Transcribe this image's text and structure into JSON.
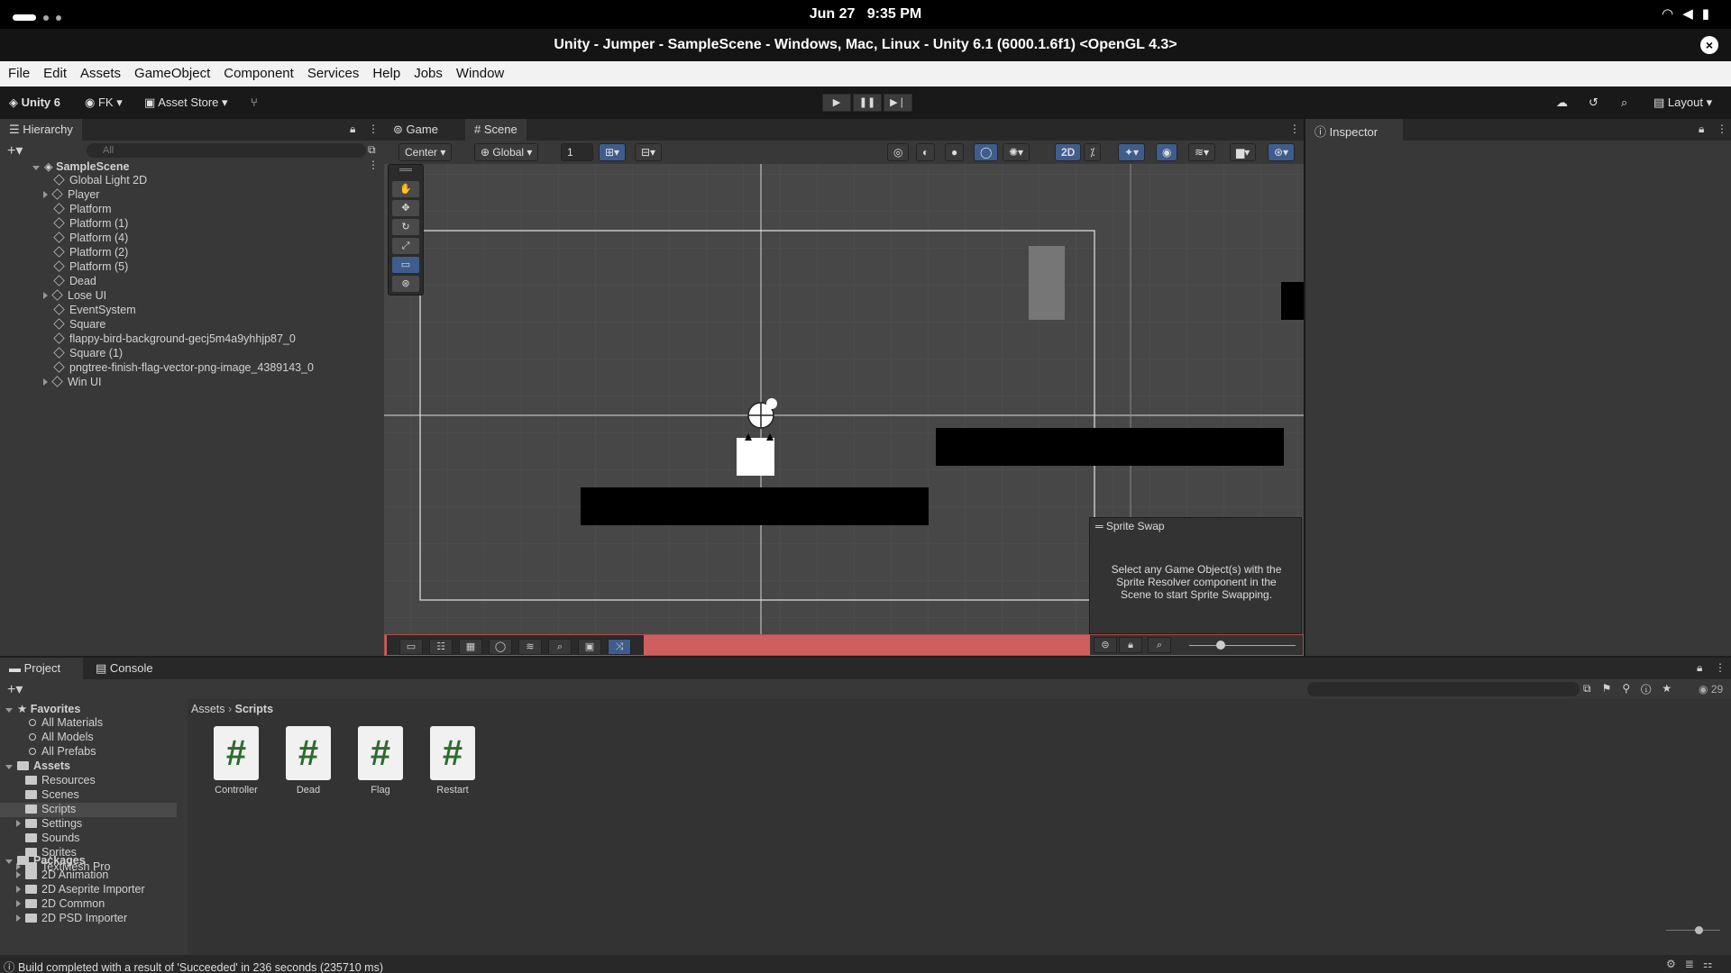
{
  "os": {
    "date": "Jun 27",
    "time": "9:35 PM"
  },
  "window": {
    "title": "Unity - Jumper - SampleScene - Windows, Mac, Linux - Unity 6.1 (6000.1.6f1) <OpenGL 4.3>"
  },
  "menu": [
    "File",
    "Edit",
    "Assets",
    "GameObject",
    "Component",
    "Services",
    "Help",
    "Jobs",
    "Window"
  ],
  "toolbar": {
    "unity_label": "Unity 6",
    "account_label": "FK",
    "asset_store_label": "Asset Store",
    "layout_label": "Layout"
  },
  "hierarchy": {
    "tab_label": "Hierarchy",
    "search_placeholder": "All",
    "scene_name": "SampleScene",
    "items": [
      {
        "label": "Global Light 2D",
        "expandable": false
      },
      {
        "label": "Player",
        "expandable": true
      },
      {
        "label": "Platform",
        "expandable": false
      },
      {
        "label": "Platform (1)",
        "expandable": false
      },
      {
        "label": "Platform (4)",
        "expandable": false
      },
      {
        "label": "Platform (2)",
        "expandable": false
      },
      {
        "label": "Platform (5)",
        "expandable": false
      },
      {
        "label": "Dead",
        "expandable": false
      },
      {
        "label": "Lose UI",
        "expandable": true
      },
      {
        "label": "EventSystem",
        "expandable": false
      },
      {
        "label": "Square",
        "expandable": false
      },
      {
        "label": "flappy-bird-background-gecj5m4a9yhhjp87_0",
        "expandable": false
      },
      {
        "label": "Square (1)",
        "expandable": false
      },
      {
        "label": "pngtree-finish-flag-vector-png-image_4389143_0",
        "expandable": false
      },
      {
        "label": "Win UI",
        "expandable": true
      }
    ]
  },
  "scene_view": {
    "tab_game": "Game",
    "tab_scene": "Scene",
    "pivot_label": "Center",
    "space_label": "Global",
    "grid_snap_value": "1",
    "mode_2d_label": "2D",
    "sprite_swap": {
      "title": "Sprite Swap",
      "message": "Select any Game Object(s) with the Sprite Resolver component in the Scene to start Sprite Swapping."
    }
  },
  "inspector": {
    "tab_label": "Inspector"
  },
  "project": {
    "tab_project": "Project",
    "tab_console": "Console",
    "hidden_count": "29",
    "breadcrumb": [
      "Assets",
      "Scripts"
    ],
    "favorites_label": "Favorites",
    "favorites": [
      "All Materials",
      "All Models",
      "All Prefabs"
    ],
    "assets_label": "Assets",
    "assets_folders": [
      {
        "label": "Resources",
        "expandable": false
      },
      {
        "label": "Scenes",
        "expandable": false
      },
      {
        "label": "Scripts",
        "expandable": false,
        "selected": true
      },
      {
        "label": "Settings",
        "expandable": true
      },
      {
        "label": "Sounds",
        "expandable": false
      },
      {
        "label": "Sprites",
        "expandable": false
      },
      {
        "label": "TextMesh Pro",
        "expandable": true
      }
    ],
    "packages_label": "Packages",
    "packages": [
      "2D Animation",
      "2D Aseprite Importer",
      "2D Common",
      "2D PSD Importer"
    ],
    "scripts": [
      "Controller",
      "Dead",
      "Flag",
      "Restart"
    ]
  },
  "status_bar": {
    "message": "Build completed with a result of 'Succeeded' in 236 seconds (235710 ms)"
  },
  "colors": {
    "selection": "#3e5d8c",
    "scene_bg": "#474747",
    "play_mode_tint": "#e06060"
  }
}
